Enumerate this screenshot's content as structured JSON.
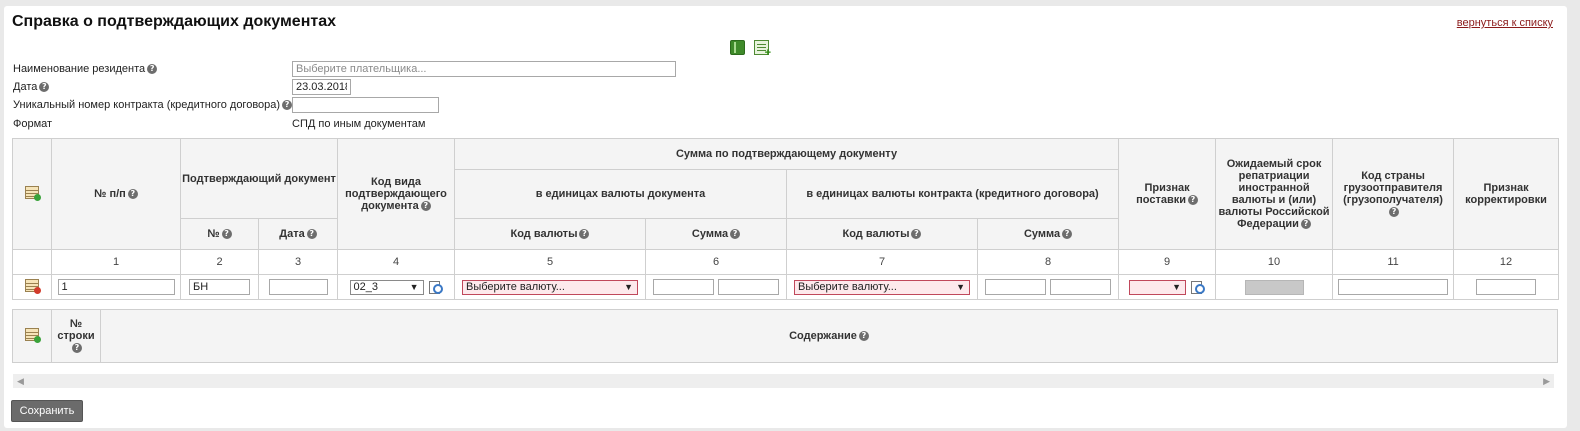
{
  "page": {
    "title": "Справка о подтверждающих документах",
    "back_link": "вернуться к списку"
  },
  "top_icons": [
    "book-icon",
    "sheet-add-icon"
  ],
  "form": {
    "resident_label": "Наименование резидента",
    "resident_placeholder": "Выберите плательщика...",
    "date_label": "Дата",
    "date_value": "23.03.2018",
    "contract_label": "Уникальный номер контракта (кредитного договора)",
    "contract_value": "",
    "format_label": "Формат",
    "format_value": "СПД по иным документам"
  },
  "table": {
    "headers": {
      "num": "№ п/п",
      "confirming_doc": "Подтверждающий документ",
      "doc_no": "№",
      "doc_date": "Дата",
      "doc_type_code": "Код вида подтверждающего документа",
      "sum_by_doc": "Сумма по подтверждающему документу",
      "in_doc_currency": "в единицах валюты документа",
      "in_contract_currency": "в единицах валюты контракта (кредитного договора)",
      "currency_code": "Код валюты",
      "amount": "Сумма",
      "delivery_sign": "Признак поставки",
      "repatriation": "Ожидаемый срок репатриации иностранной валюты и (или) валюты Российской Федерации",
      "country_code": "Код страны грузоотправителя (грузополучателя)",
      "correction_sign": "Признак корректировки"
    },
    "column_numbers": [
      "1",
      "2",
      "3",
      "4",
      "5",
      "6",
      "7",
      "8",
      "9",
      "10",
      "11",
      "12"
    ],
    "row": {
      "num": "1",
      "doc_no": "БН",
      "doc_date": "",
      "doc_type": "02_3",
      "currency_placeholder": "Выберите валюту...",
      "contract_currency_placeholder": "Выберите валюту...",
      "delivery_sign": ""
    }
  },
  "content_table": {
    "line_no": "№ строки",
    "content": "Содержание"
  },
  "buttons": {
    "save": "Сохранить"
  },
  "colors": {
    "required_border": "#c0485b",
    "required_bg": "#fde9ec",
    "link": "#8b1a1a",
    "button": "#6b6b6b"
  }
}
